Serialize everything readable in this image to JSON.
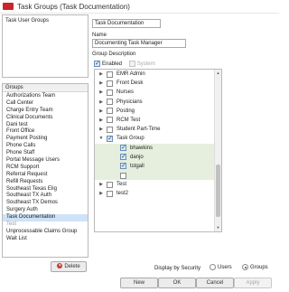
{
  "window": {
    "title": "Task Groups (Task Documentation)"
  },
  "left_top": {
    "header": "Task User Groups"
  },
  "groups": {
    "header": "Groups",
    "items": [
      {
        "label": "Authorizations Team"
      },
      {
        "label": "Call Center"
      },
      {
        "label": "Charge Entry Team"
      },
      {
        "label": "Clinical Documents"
      },
      {
        "label": "Dani test"
      },
      {
        "label": "Front Office"
      },
      {
        "label": "Payment Posting"
      },
      {
        "label": "Phone Calls"
      },
      {
        "label": "Phone Staff"
      },
      {
        "label": "Portal Message Users"
      },
      {
        "label": "RCM Support"
      },
      {
        "label": "Referral Request"
      },
      {
        "label": "Refill Requests"
      },
      {
        "label": "Southeast Texas Elig"
      },
      {
        "label": "Southeast TX Auth"
      },
      {
        "label": "Southeast TX Demos"
      },
      {
        "label": "Surgery Auth"
      },
      {
        "label": "Task Documentation"
      },
      {
        "label": "Test"
      },
      {
        "label": "Unprocessable Claims Group"
      },
      {
        "label": "Wait List"
      }
    ],
    "selected": "Task Documentation",
    "delete_label": "Delete"
  },
  "detail": {
    "name_value": "Task Documentation",
    "name_label": "Name",
    "description_value": "Documenting Task Manager",
    "group_description_label": "Group Description",
    "enabled_label": "Enabled",
    "enabled_checked": true,
    "system_label": "System",
    "system_checked": false
  },
  "tree": {
    "rows": [
      {
        "label": "EMR Admin",
        "checked": false,
        "expand": "right",
        "indent": 0
      },
      {
        "label": "Front Desk",
        "checked": false,
        "expand": "right",
        "indent": 0
      },
      {
        "label": "Nurses",
        "checked": false,
        "expand": "right",
        "indent": 0
      },
      {
        "label": "Physicians",
        "checked": false,
        "expand": "right",
        "indent": 0
      },
      {
        "label": "Posting",
        "checked": false,
        "expand": "right",
        "indent": 0
      },
      {
        "label": "RCM Test",
        "checked": false,
        "expand": "right",
        "indent": 0
      },
      {
        "label": "Student Part-Time",
        "checked": false,
        "expand": "right",
        "indent": 0
      },
      {
        "label": "Task Group",
        "checked": true,
        "expand": "down",
        "indent": 0
      },
      {
        "label": "bhawkins",
        "checked": true,
        "expand": "",
        "indent": 1
      },
      {
        "label": "danjo",
        "checked": true,
        "expand": "",
        "indent": 1
      },
      {
        "label": "tstgall",
        "checked": true,
        "expand": "",
        "indent": 1
      },
      {
        "label": "",
        "checked": false,
        "expand": "",
        "indent": 1
      },
      {
        "label": "Test",
        "checked": false,
        "expand": "right",
        "indent": 0
      },
      {
        "label": "test2",
        "checked": false,
        "expand": "right",
        "indent": 0
      }
    ]
  },
  "footer": {
    "display_by_label": "Display by Security",
    "users_label": "Users",
    "groups_label": "Groups",
    "selected_mode": "Groups",
    "new_label": "New",
    "ok_label": "OK",
    "cancel_label": "Cancel",
    "apply_label": "Apply"
  }
}
